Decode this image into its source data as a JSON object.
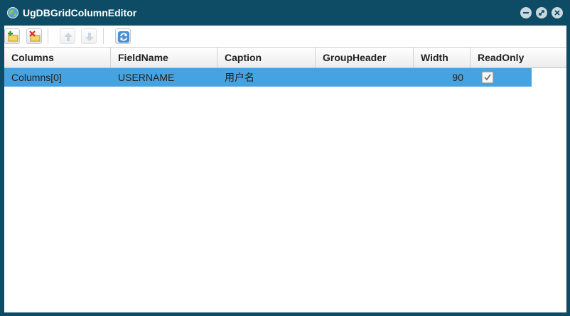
{
  "window": {
    "title": "UgDBGridColumnEditor",
    "title_icon": "globe-icon",
    "controls": [
      "minimize-icon",
      "restore-icon",
      "close-icon"
    ],
    "colors": {
      "titlebar": "#0e4c66",
      "selection": "#46a3e0"
    }
  },
  "toolbar": {
    "buttons": [
      {
        "name": "add-column-button",
        "icon": "add-icon",
        "enabled": true
      },
      {
        "name": "delete-column-button",
        "icon": "delete-icon",
        "enabled": true
      },
      {
        "name": "move-up-button",
        "icon": "arrow-up-icon",
        "enabled": false
      },
      {
        "name": "move-down-button",
        "icon": "arrow-down-icon",
        "enabled": false
      },
      {
        "name": "refresh-button",
        "icon": "refresh-icon",
        "enabled": true
      }
    ]
  },
  "grid": {
    "columns": [
      "Columns",
      "FieldName",
      "Caption",
      "GroupHeader",
      "Width",
      "ReadOnly"
    ],
    "rows": [
      {
        "columns": "Columns[0]",
        "field_name": "USERNAME",
        "caption": "用户名",
        "group_header": "",
        "width": "90",
        "read_only": true,
        "selected": true
      }
    ]
  }
}
